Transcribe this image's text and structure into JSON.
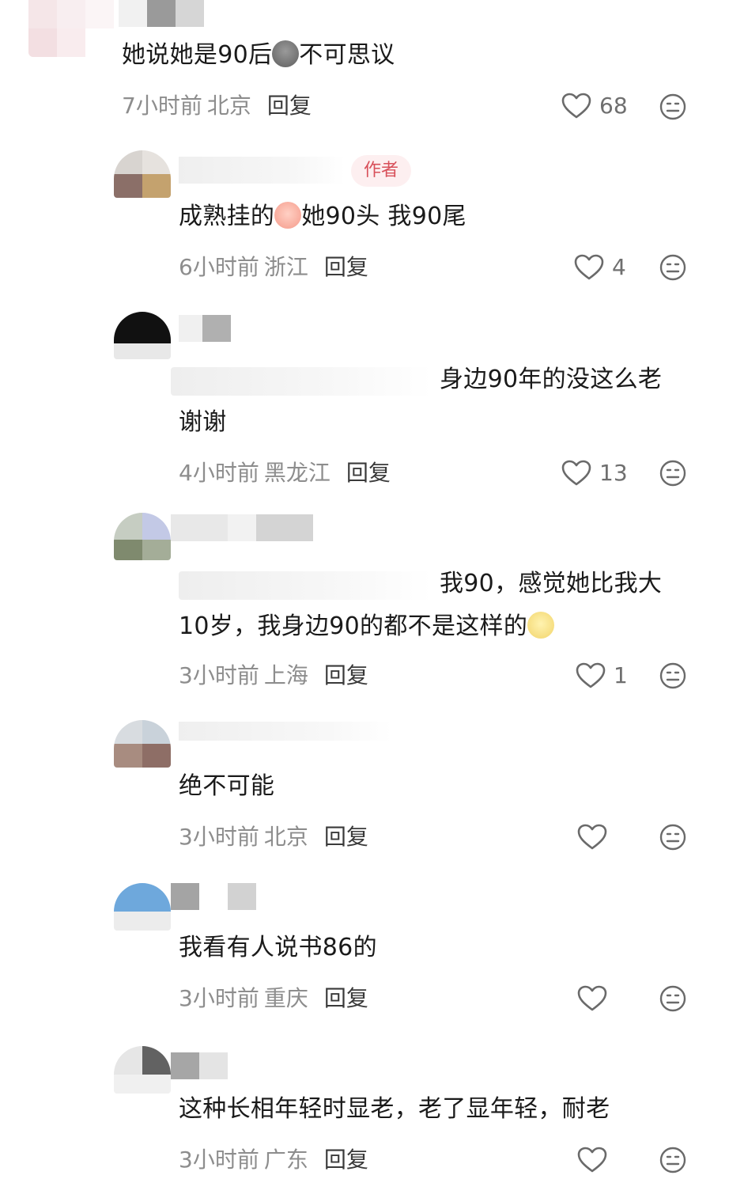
{
  "comments": [
    {
      "text": "她说她是90后",
      "text_after": "不可思议",
      "time": "7小时前",
      "location": "北京",
      "reply_label": "回复",
      "likes": "68"
    },
    {
      "badge": "作者",
      "text": "成熟挂的",
      "text_after": "她90头 我90尾",
      "time": "6小时前",
      "location": "浙江",
      "reply_label": "回复",
      "likes": "4"
    },
    {
      "text_line1": "身边90年的没这么老",
      "text_line2": "谢谢",
      "time": "4小时前",
      "location": "黑龙江",
      "reply_label": "回复",
      "likes": "13"
    },
    {
      "text_line1": "我90，感觉她比我大",
      "text_line2": "10岁，我身边90的都不是这样的",
      "time": "3小时前",
      "location": "上海",
      "reply_label": "回复",
      "likes": "1"
    },
    {
      "text": "绝不可能",
      "time": "3小时前",
      "location": "北京",
      "reply_label": "回复",
      "likes": ""
    },
    {
      "text": "我看有人说书86的",
      "time": "3小时前",
      "location": "重庆",
      "reply_label": "回复",
      "likes": ""
    },
    {
      "text": "这种长相年轻时显老，老了显年轻，耐老",
      "time": "3小时前",
      "location": "广东",
      "reply_label": "回复",
      "likes": ""
    }
  ],
  "icons": {
    "like": "heart-outline-icon",
    "dislike": "meh-face-icon",
    "emoji_1": "poop-emoji",
    "emoji_2": "crying-face-emoji",
    "emoji_3": "dog-face-emoji"
  },
  "colors": {
    "badge_bg": "#fdeff0",
    "badge_text": "#d8505a",
    "meta_text": "#8d8d8d",
    "icon_stroke": "#6a6a6a"
  }
}
